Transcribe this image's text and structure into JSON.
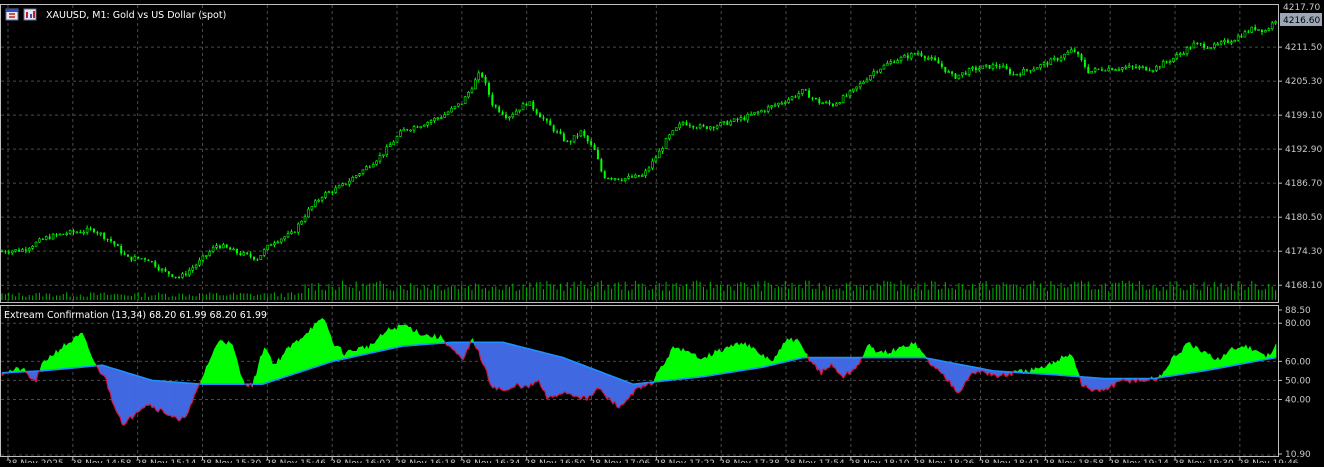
{
  "window": {
    "symbol_title": "XAUUSD, M1:  Gold vs US Dollar (spot)",
    "current_price": "4216.60",
    "partial_top_price": "4217.70"
  },
  "colors": {
    "background": "#000000",
    "grid": "#4a4a4a",
    "candle": "#00ff00",
    "volume": "#00b400",
    "price_label_bg": "#9ca8b8",
    "indicator_green": "#00ff00",
    "indicator_blue": "#4169e1",
    "indicator_red": "#dc143c",
    "axis_text": "#c8c8c8"
  },
  "icons": [
    "chart-window-icon",
    "chart-toolbar-icon"
  ],
  "main_chart": {
    "y_ticks": [
      "4211.50",
      "4205.30",
      "4199.10",
      "4192.90",
      "4186.70",
      "4180.50",
      "4174.30",
      "4168.10"
    ],
    "y_tick_values": [
      4211.5,
      4205.3,
      4199.1,
      4192.9,
      4186.7,
      4180.5,
      4174.3,
      4168.1
    ]
  },
  "indicator": {
    "title": "Extream Confirmation (13,34) 68.20 61.99 68.20 61.99",
    "y_ticks": [
      "88.50",
      "80.00",
      "60.00",
      "50.00",
      "40.00",
      "10.90"
    ],
    "y_tick_values": [
      88.5,
      80,
      60,
      50,
      40,
      10.9
    ]
  },
  "time_axis": {
    "labels": [
      "28 Nov 2025",
      "28 Nov 14:58",
      "28 Nov 15:14",
      "28 Nov 15:30",
      "28 Nov 15:46",
      "28 Nov 16:02",
      "28 Nov 16:18",
      "28 Nov 16:34",
      "28 Nov 16:50",
      "28 Nov 17:06",
      "28 Nov 17:22",
      "28 Nov 17:38",
      "28 Nov 17:54",
      "28 Nov 18:10",
      "28 Nov 18:26",
      "28 Nov 18:42",
      "28 Nov 18:58",
      "28 Nov 19:14",
      "28 Nov 19:30",
      "28 Nov 19:46"
    ]
  },
  "chart_data": {
    "type": "line",
    "series": [
      {
        "price_keyframes": [
          [
            0,
            4174.3
          ],
          [
            20,
            4174.5
          ],
          [
            45,
            4176.8
          ],
          [
            65,
            4177.6
          ],
          [
            92,
            4178.2
          ],
          [
            110,
            4176
          ],
          [
            125,
            4173
          ],
          [
            145,
            4173
          ],
          [
            162,
            4170.5
          ],
          [
            178,
            4169.5
          ],
          [
            195,
            4172
          ],
          [
            215,
            4175.5
          ],
          [
            235,
            4174
          ],
          [
            255,
            4173
          ],
          [
            270,
            4176
          ],
          [
            290,
            4177.5
          ],
          [
            305,
            4181.5
          ],
          [
            320,
            4184.5
          ],
          [
            338,
            4186
          ],
          [
            360,
            4189
          ],
          [
            380,
            4192
          ],
          [
            400,
            4196.3
          ],
          [
            420,
            4197.5
          ],
          [
            440,
            4199
          ],
          [
            460,
            4201.5
          ],
          [
            478,
            4207
          ],
          [
            490,
            4201
          ],
          [
            505,
            4198.8
          ],
          [
            525,
            4201.5
          ],
          [
            545,
            4197.5
          ],
          [
            565,
            4194
          ],
          [
            578,
            4196
          ],
          [
            592,
            4192.5
          ],
          [
            600,
            4188
          ],
          [
            620,
            4187.5
          ],
          [
            640,
            4188
          ],
          [
            655,
            4192
          ],
          [
            665,
            4195
          ],
          [
            680,
            4197.8
          ],
          [
            700,
            4196.8
          ],
          [
            720,
            4197.5
          ],
          [
            740,
            4198.5
          ],
          [
            760,
            4200
          ],
          [
            785,
            4202
          ],
          [
            800,
            4203.5
          ],
          [
            815,
            4201.5
          ],
          [
            830,
            4201
          ],
          [
            850,
            4203.5
          ],
          [
            870,
            4207
          ],
          [
            890,
            4209
          ],
          [
            915,
            4210.5
          ],
          [
            935,
            4208.5
          ],
          [
            950,
            4206
          ],
          [
            970,
            4207.5
          ],
          [
            995,
            4208.2
          ],
          [
            1010,
            4206.5
          ],
          [
            1035,
            4208
          ],
          [
            1055,
            4209.5
          ],
          [
            1070,
            4211
          ],
          [
            1085,
            4207
          ],
          [
            1100,
            4207.6
          ],
          [
            1125,
            4207.8
          ],
          [
            1150,
            4207.6
          ],
          [
            1170,
            4209.5
          ],
          [
            1190,
            4212
          ],
          [
            1210,
            4211.6
          ],
          [
            1230,
            4213
          ],
          [
            1250,
            4215
          ],
          [
            1262,
            4214.5
          ],
          [
            1272,
            4216.6
          ]
        ]
      },
      {
        "indicator_fast_keyframes": [
          [
            0,
            54
          ],
          [
            20,
            56
          ],
          [
            33,
            49
          ],
          [
            42,
            60
          ],
          [
            62,
            68
          ],
          [
            80,
            74
          ],
          [
            95,
            56
          ],
          [
            102,
            53
          ],
          [
            110,
            40
          ],
          [
            122,
            26
          ],
          [
            134,
            34
          ],
          [
            145,
            38
          ],
          [
            156,
            35
          ],
          [
            168,
            32
          ],
          [
            178,
            28
          ],
          [
            188,
            36
          ],
          [
            196,
            46
          ],
          [
            205,
            58
          ],
          [
            218,
            72
          ],
          [
            230,
            68
          ],
          [
            240,
            50
          ],
          [
            250,
            47
          ],
          [
            262,
            68
          ],
          [
            272,
            58
          ],
          [
            285,
            66
          ],
          [
            300,
            73
          ],
          [
            310,
            78
          ],
          [
            322,
            82
          ],
          [
            330,
            70
          ],
          [
            342,
            64
          ],
          [
            352,
            66
          ],
          [
            368,
            68
          ],
          [
            385,
            76
          ],
          [
            402,
            79
          ],
          [
            420,
            74
          ],
          [
            440,
            72
          ],
          [
            460,
            60
          ],
          [
            470,
            72
          ],
          [
            478,
            62
          ],
          [
            488,
            48
          ],
          [
            495,
            46
          ],
          [
            505,
            44
          ],
          [
            515,
            48
          ],
          [
            525,
            46
          ],
          [
            535,
            50
          ],
          [
            545,
            40
          ],
          [
            560,
            44
          ],
          [
            575,
            42
          ],
          [
            585,
            40
          ],
          [
            595,
            46
          ],
          [
            606,
            40
          ],
          [
            618,
            36
          ],
          [
            630,
            44
          ],
          [
            648,
            48
          ],
          [
            660,
            58
          ],
          [
            672,
            68
          ],
          [
            685,
            64
          ],
          [
            700,
            62
          ],
          [
            720,
            66
          ],
          [
            740,
            70
          ],
          [
            755,
            64
          ],
          [
            770,
            60
          ],
          [
            785,
            72
          ],
          [
            795,
            70
          ],
          [
            805,
            62
          ],
          [
            818,
            54
          ],
          [
            828,
            58
          ],
          [
            840,
            52
          ],
          [
            852,
            56
          ],
          [
            865,
            68
          ],
          [
            878,
            64
          ],
          [
            895,
            66
          ],
          [
            910,
            70
          ],
          [
            925,
            60
          ],
          [
            945,
            50
          ],
          [
            955,
            44
          ],
          [
            965,
            52
          ],
          [
            978,
            55
          ],
          [
            995,
            52
          ],
          [
            1012,
            54
          ],
          [
            1040,
            56
          ],
          [
            1058,
            62
          ],
          [
            1068,
            64
          ],
          [
            1078,
            48
          ],
          [
            1090,
            44
          ],
          [
            1105,
            46
          ],
          [
            1120,
            50
          ],
          [
            1140,
            50
          ],
          [
            1155,
            51
          ],
          [
            1170,
            62
          ],
          [
            1185,
            69
          ],
          [
            1200,
            64
          ],
          [
            1215,
            61
          ],
          [
            1228,
            66
          ],
          [
            1240,
            68
          ],
          [
            1252,
            66
          ],
          [
            1262,
            62
          ],
          [
            1272,
            68.2
          ]
        ],
        "indicator_slow_keyframes": [
          [
            0,
            54
          ],
          [
            40,
            55
          ],
          [
            100,
            58
          ],
          [
            150,
            50
          ],
          [
            200,
            48
          ],
          [
            260,
            48
          ],
          [
            330,
            60
          ],
          [
            400,
            68
          ],
          [
            450,
            70
          ],
          [
            500,
            70
          ],
          [
            560,
            62
          ],
          [
            630,
            48
          ],
          [
            700,
            52
          ],
          [
            760,
            57
          ],
          [
            800,
            62
          ],
          [
            860,
            62
          ],
          [
            920,
            62
          ],
          [
            990,
            55
          ],
          [
            1050,
            53
          ],
          [
            1100,
            51
          ],
          [
            1150,
            51
          ],
          [
            1200,
            55
          ],
          [
            1272,
            62
          ]
        ]
      }
    ]
  }
}
